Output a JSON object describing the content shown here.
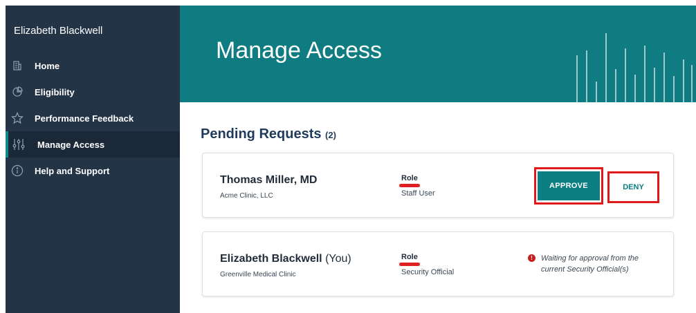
{
  "sidebar": {
    "user_name": "Elizabeth Blackwell",
    "items": [
      {
        "label": "Home",
        "icon": "building-icon"
      },
      {
        "label": "Eligibility",
        "icon": "pie-chart-icon"
      },
      {
        "label": "Performance Feedback",
        "icon": "star-icon"
      },
      {
        "label": "Manage Access",
        "icon": "sliders-icon",
        "active": true
      },
      {
        "label": "Help and Support",
        "icon": "info-icon"
      }
    ]
  },
  "banner": {
    "title": "Manage Access"
  },
  "pending": {
    "title": "Pending Requests",
    "count": "(2)",
    "requests": [
      {
        "name": "Thomas Miller, MD",
        "organization": "Acme Clinic, LLC",
        "role_label": "Role",
        "role_value": "Staff User",
        "approve_label": "APPROVE",
        "deny_label": "DENY"
      },
      {
        "name": "Elizabeth Blackwell",
        "name_suffix": "(You)",
        "organization": "Greenville Medical Clinic",
        "role_label": "Role",
        "role_value": "Security Official",
        "status_text": "Waiting for approval from the current Security Official(s)"
      }
    ]
  },
  "colors": {
    "sidebar_bg": "#243447",
    "banner_bg": "#0e7c80",
    "accent": "#0c7f82",
    "highlight_red": "#e01818"
  }
}
